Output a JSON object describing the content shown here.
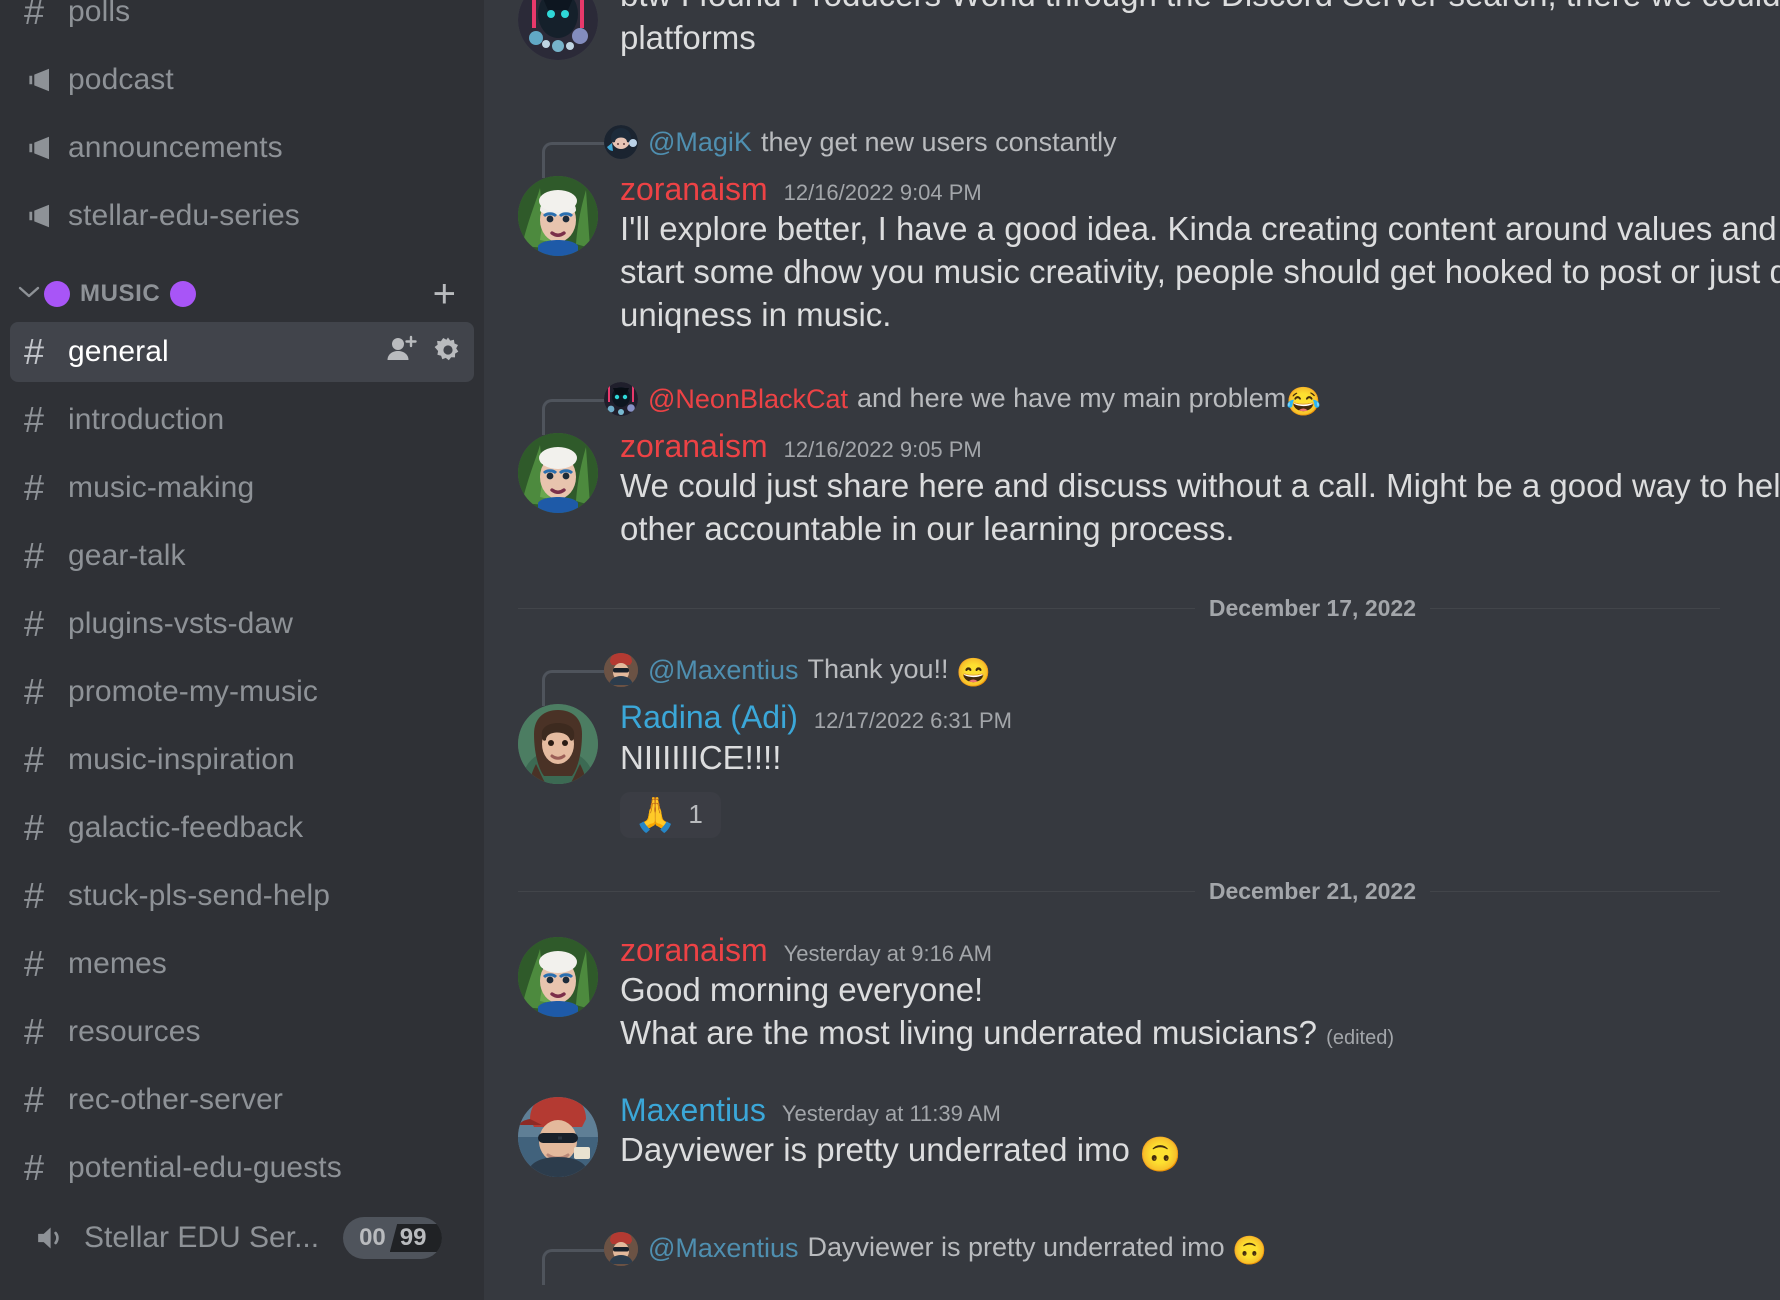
{
  "sidebar": {
    "top_channels": [
      {
        "name": "polls",
        "icon": "hash-icon",
        "type": "text"
      },
      {
        "name": "podcast",
        "icon": "megaphone-icon",
        "type": "announcement"
      },
      {
        "name": "announcements",
        "icon": "megaphone-icon",
        "type": "announcement"
      },
      {
        "name": "stellar-edu-series",
        "icon": "megaphone-icon",
        "type": "announcement"
      }
    ],
    "category": {
      "label": "MUSIC",
      "left_emoji": "🟣",
      "right_emoji": "🟣",
      "caret": "chevron-down-icon",
      "add_label": "+",
      "dot_color": "#a855f7"
    },
    "music_channels": [
      {
        "name": "general",
        "icon": "hash-icon",
        "active": true,
        "actions": [
          "add-member-icon",
          "gear-icon"
        ]
      },
      {
        "name": "introduction",
        "icon": "hash-icon",
        "active": false
      },
      {
        "name": "music-making",
        "icon": "hash-icon",
        "active": false
      },
      {
        "name": "gear-talk",
        "icon": "hash-icon",
        "active": false
      },
      {
        "name": "plugins-vsts-daw",
        "icon": "hash-icon",
        "active": false
      },
      {
        "name": "promote-my-music",
        "icon": "hash-icon",
        "active": false
      },
      {
        "name": "music-inspiration",
        "icon": "hash-icon",
        "active": false
      },
      {
        "name": "galactic-feedback",
        "icon": "hash-icon",
        "active": false
      },
      {
        "name": "stuck-pls-send-help",
        "icon": "hash-icon",
        "active": false
      },
      {
        "name": "memes",
        "icon": "hash-icon",
        "active": false
      },
      {
        "name": "resources",
        "icon": "hash-icon",
        "active": false
      },
      {
        "name": "rec-other-server",
        "icon": "hash-icon",
        "active": false
      },
      {
        "name": "potential-edu-guests",
        "icon": "hash-icon",
        "active": false
      }
    ],
    "voice_channel": {
      "name": "Stellar EDU Ser...",
      "icon": "speaker-icon",
      "current": "00",
      "limit": "99"
    }
  },
  "colors": {
    "sidebar_bg": "#2f3136",
    "chat_bg": "#36393f",
    "active_channel_bg": "#41444b",
    "text_muted": "#8e9297",
    "text_normal": "#dcddde",
    "name_red": "#ed4245",
    "name_blue": "#3ba7d8",
    "mention_blue": "#4f8fb0",
    "accent_purple": "#a855f7"
  },
  "messages": [
    {
      "kind": "continuation",
      "author": "",
      "avatar": "neon-cat-avatar",
      "lines": [
        "btw I found Producers World through the Discord Server search, there we could also a",
        "platforms"
      ]
    },
    {
      "kind": "message",
      "author": "zoranaism",
      "author_color": "#ed4245",
      "avatar": "zoranaism-avatar",
      "timestamp": "12/16/2022 9:04 PM",
      "reply_to": {
        "name": "@MagiK",
        "name_color": "#4f8fb0",
        "text": "they get new users constantly",
        "avatar": "magik-avatar"
      },
      "lines": [
        "I'll explore better, I have a good idea. Kinda creating content around values and ours is",
        "start some dhow you music creativity, people should get hooked to post or just discus",
        "uniqness in music."
      ]
    },
    {
      "kind": "message",
      "author": "zoranaism",
      "author_color": "#ed4245",
      "avatar": "zoranaism-avatar",
      "timestamp": "12/16/2022 9:05 PM",
      "reply_to": {
        "name": "@NeonBlackCat",
        "name_color": "#ed4245",
        "text": "and here we have my main problem",
        "emoji": "😂",
        "avatar": "neon-cat-avatar"
      },
      "lines": [
        "We could just share here and discuss without a call. Might be a good way to help each",
        "other accountable in our learning process."
      ]
    },
    {
      "kind": "divider",
      "date": "December 17, 2022"
    },
    {
      "kind": "message",
      "author": "Radina (Adi)",
      "author_color": "#3ba7d8",
      "avatar": "radina-avatar",
      "timestamp": "12/17/2022 6:31 PM",
      "reply_to": {
        "name": "@Maxentius",
        "name_color": "#4f8fb0",
        "text": "Thank you!!",
        "emoji": "😄",
        "avatar": "maxentius-avatar"
      },
      "lines": [
        "NIIIIIICE!!!!"
      ],
      "reactions": [
        {
          "emoji": "🙏",
          "count": "1"
        }
      ]
    },
    {
      "kind": "divider",
      "date": "December 21, 2022"
    },
    {
      "kind": "message",
      "author": "zoranaism",
      "author_color": "#ed4245",
      "avatar": "zoranaism-avatar",
      "timestamp": "Yesterday at 9:16 AM",
      "lines": [
        "Good morning everyone!",
        "What are the most living underrated musicians?"
      ],
      "edited": "(edited)"
    },
    {
      "kind": "message",
      "author": "Maxentius",
      "author_color": "#3ba7d8",
      "avatar": "maxentius-avatar",
      "timestamp": "Yesterday at 11:39 AM",
      "lines": [
        "Dayviewer is pretty underrated imo"
      ],
      "trailing_emoji": "🙃"
    },
    {
      "kind": "reply-only",
      "reply_to": {
        "name": "@Maxentius",
        "name_color": "#4f8fb0",
        "text": "Dayviewer is pretty underrated imo",
        "emoji": "🙃",
        "avatar": "maxentius-avatar"
      }
    }
  ]
}
